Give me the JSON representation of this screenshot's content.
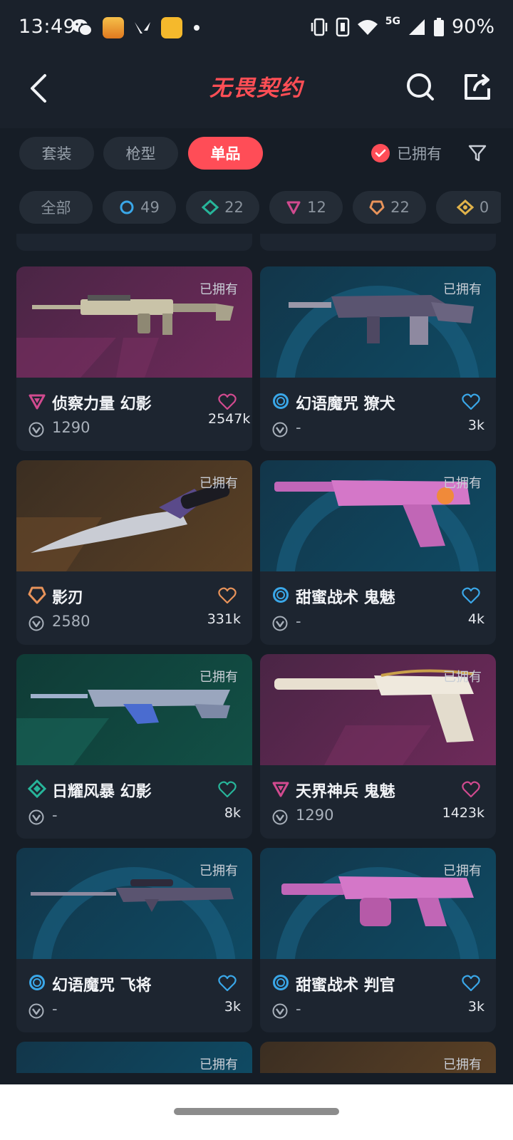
{
  "status_bar": {
    "time": "13:49",
    "network": "5G",
    "battery": "90%"
  },
  "header": {
    "title": "无畏契约",
    "back_icon": "chevron-left-icon",
    "search_icon": "search-icon",
    "share_icon": "share-icon"
  },
  "category_tabs": [
    {
      "label": "套装",
      "active": false
    },
    {
      "label": "枪型",
      "active": false
    },
    {
      "label": "单品",
      "active": true
    }
  ],
  "owned_filter": {
    "label": "已拥有",
    "checked": true
  },
  "rarity_chips": [
    {
      "label": "全部"
    },
    {
      "count": "49",
      "icon": "select-tier-icon",
      "color": "#3aa7e8"
    },
    {
      "count": "22",
      "icon": "deluxe-tier-icon",
      "color": "#27b59a"
    },
    {
      "count": "12",
      "icon": "premium-tier-icon",
      "color": "#d14a8f"
    },
    {
      "count": "22",
      "icon": "exclusive-tier-icon",
      "color": "#e8935a"
    },
    {
      "count": "0",
      "icon": "ultra-tier-icon",
      "color": "#e0b24a"
    }
  ],
  "owned_badge": "已拥有",
  "items": [
    {
      "name": "侦察力量 幻影",
      "price": "1290",
      "likes": "2547k",
      "tier": "premium",
      "tier_color": "#d14a8f",
      "bg": "magenta"
    },
    {
      "name": "幻语魔咒 獠犬",
      "price": "-",
      "likes": "3k",
      "tier": "select",
      "tier_color": "#3aa7e8",
      "bg": "teal"
    },
    {
      "name": "影刃",
      "price": "2580",
      "likes": "331k",
      "tier": "exclusive",
      "tier_color": "#e8935a",
      "bg": "bronze"
    },
    {
      "name": "甜蜜战术 鬼魅",
      "price": "-",
      "likes": "4k",
      "tier": "select",
      "tier_color": "#3aa7e8",
      "bg": "teal"
    },
    {
      "name": "日耀风暴 幻影",
      "price": "-",
      "likes": "8k",
      "tier": "deluxe",
      "tier_color": "#27b59a",
      "bg": "green"
    },
    {
      "name": "天界神兵 鬼魅",
      "price": "1290",
      "likes": "1423k",
      "tier": "premium",
      "tier_color": "#d14a8f",
      "bg": "magenta"
    },
    {
      "name": "幻语魔咒 飞将",
      "price": "-",
      "likes": "3k",
      "tier": "select",
      "tier_color": "#3aa7e8",
      "bg": "teal"
    },
    {
      "name": "甜蜜战术 判官",
      "price": "-",
      "likes": "3k",
      "tier": "select",
      "tier_color": "#3aa7e8",
      "bg": "teal"
    }
  ]
}
